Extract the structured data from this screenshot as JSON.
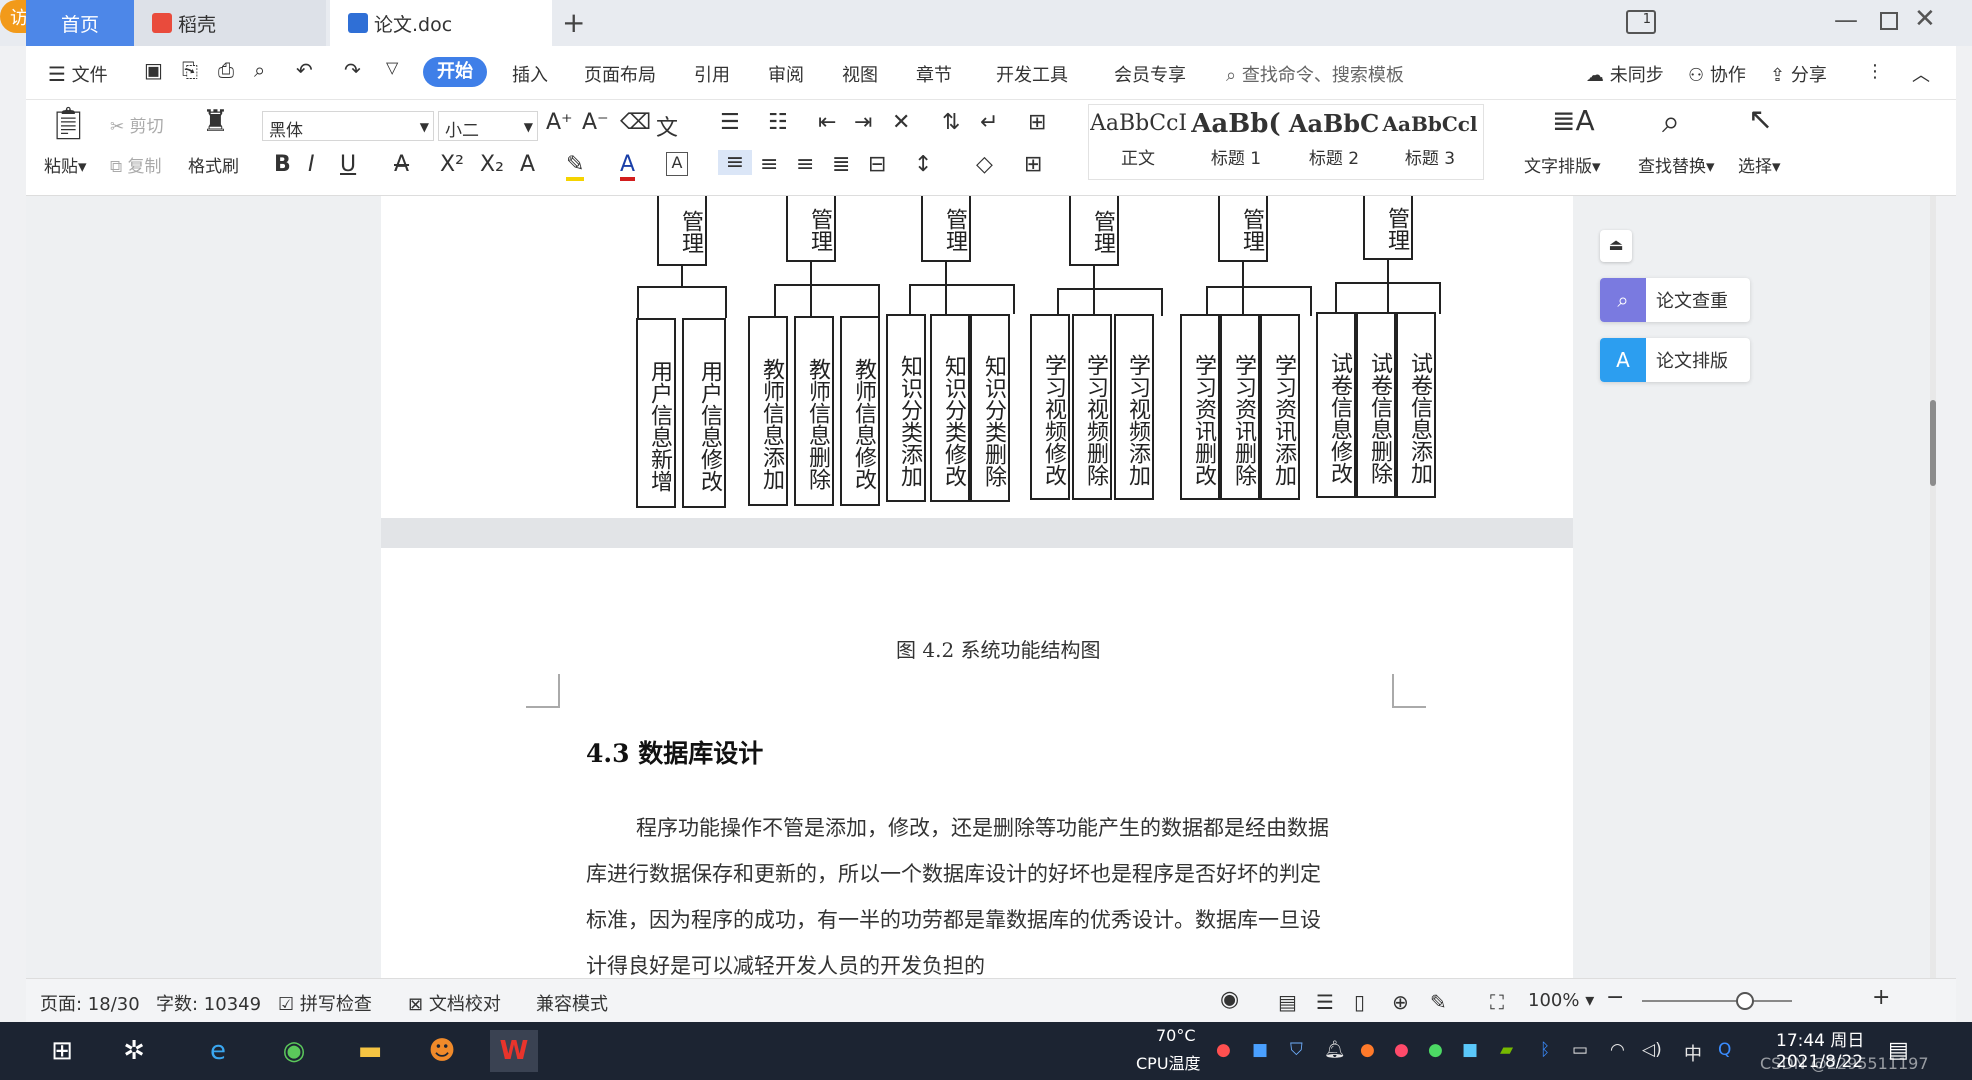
{
  "tabs": [
    {
      "label": "首页"
    },
    {
      "label": "稻壳"
    },
    {
      "label": "论文.doc"
    }
  ],
  "titlebar": {
    "login": "访客登录"
  },
  "menu": {
    "file": "文件",
    "items": [
      "开始",
      "插入",
      "页面布局",
      "引用",
      "审阅",
      "视图",
      "章节",
      "开发工具",
      "会员专享"
    ],
    "search_placeholder": "查找命令、搜索模板",
    "right": [
      "未同步",
      "协作",
      "分享"
    ]
  },
  "ribbon": {
    "paste": "粘贴",
    "cut": "剪切",
    "copy": "复制",
    "format_painter": "格式刷",
    "font_name": "黑体",
    "font_size": "小二",
    "styles": [
      {
        "preview": "AaBbCcI",
        "name": "正文"
      },
      {
        "preview": "AaBb(",
        "name": "标题 1"
      },
      {
        "preview": "AaBbC",
        "name": "标题 2"
      },
      {
        "preview": "AaBbCcl",
        "name": "标题 3"
      }
    ],
    "text_layout": "文字排版",
    "find_replace": "查找替换",
    "select": "选择"
  },
  "diagram": {
    "manage_boxes": [
      "管理",
      "管理",
      "管理",
      "管理",
      "管理",
      "管理"
    ],
    "groups": [
      [
        "用户信息新增",
        "用户信息修改"
      ],
      [
        "教师信息添加",
        "教师信息删除",
        "教师信息修改"
      ],
      [
        "知识分类添加",
        "知识分类修改",
        "知识分类删除"
      ],
      [
        "学习视频修改",
        "学习视频删除",
        "学习视频添加"
      ],
      [
        "学习资讯删改",
        "学习资讯删除",
        "学习资讯添加"
      ],
      [
        "试卷信息修改",
        "试卷信息删除",
        "试卷信息添加"
      ]
    ]
  },
  "document": {
    "caption": "图 4.2  系统功能结构图",
    "section": "4.3  数据库设计",
    "paragraph_lines": [
      "程序功能操作不管是添加，修改，还是删除等功能产生的数据都是经由数据",
      "库进行数据保存和更新的，所以一个数据库设计的好坏也是程序是否好坏的判定",
      "标准，因为程序的成功，有一半的功劳都是靠数据库的优秀设计。数据库一旦设",
      "计得良好是可以减轻开发人员的开发负担的"
    ]
  },
  "side_panel": {
    "check": "论文查重",
    "layout": "论文排版"
  },
  "statusbar": {
    "page": "页面: 18/30",
    "words": "字数: 10349",
    "spell": "拼写检查",
    "proof": "文档校对",
    "compat": "兼容模式",
    "zoom": "100%"
  },
  "taskbar": {
    "cpu_temp": "70°C",
    "cpu_label": "CPU温度",
    "ime": "中",
    "time": "17:44 周日",
    "date": "2021/8/22",
    "watermark": "CSDN @2295511197"
  }
}
